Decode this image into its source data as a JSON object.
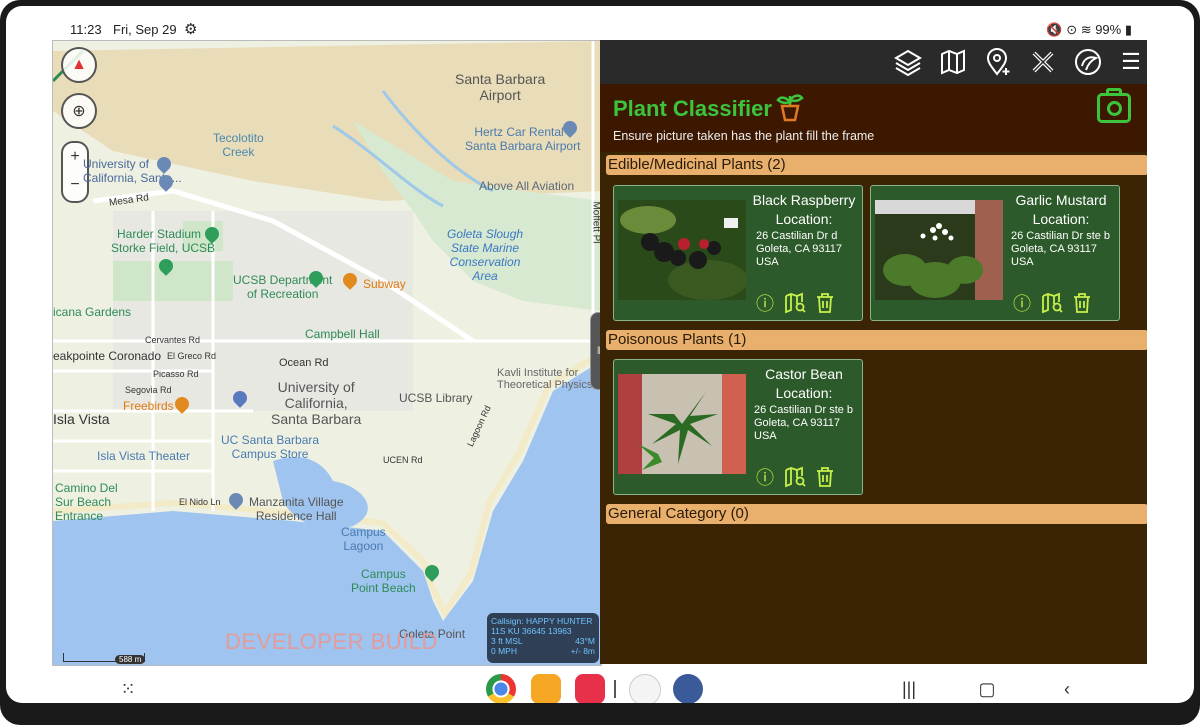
{
  "status": {
    "time": "11:23",
    "date": "Fri, Sep 29",
    "right": "99%"
  },
  "map": {
    "labels": {
      "sb_airport": "Santa Barbara\nAirport",
      "tecolotito": "Tecolotito\nCreek",
      "hertz": "Hertz Car Rental -\nSanta Barbara Airport",
      "above_all": "Above All Aviation",
      "univ_of": "University of\nCalifornia, Santa...",
      "mesa_rd": "Mesa Rd",
      "harder": "Harder Stadium",
      "storke": "Storke Field, UCSB",
      "goleta_slough": "Goleta Slough\nState Marine\nConservation\nArea",
      "moffett": "Moffett Pl",
      "ucsb_dept": "UCSB Department\nof Recreation",
      "subway": "Subway",
      "ucana": "icana Gardens",
      "campbell": "Campbell Hall",
      "cervantes": "Cervantes Rd",
      "el_greco": "El Greco Rd",
      "picasso": "Picasso Rd",
      "segovia": "Segovia Rd",
      "pointe": "eakpointe Coronado",
      "ocean": "Ocean Rd",
      "univ_cal": "University of\nCalifornia,\nSanta Barbara",
      "kavli": "Kavli Institute for\nTheoretical Physics",
      "ucsb_library": "UCSB Library",
      "freebirds": "Freebirds",
      "isla_vista": "Isla Vista",
      "uc_store": "UC Santa Barbara\nCampus Store",
      "iv_theater": "Isla Vista Theater",
      "ucen": "UCEN Rd",
      "lagoon": "Lagoon Rd",
      "camino": "Camino Del\nSur Beach\nEntrance",
      "el_nido": "El Nido Ln",
      "manzanita": "Manzanita Village\nResidence Hall",
      "campus_lagoon": "Campus\nLagoon",
      "campus_point": "Campus\nPoint Beach",
      "goleta_point": "Goleta Point"
    },
    "dev_build": "DEVELOPER BUILD",
    "scale": "588 m",
    "hud": {
      "callsign": "Callsign: HAPPY HUNTER",
      "coords": "11S  KU  36645  13963",
      "msl": "3 ft MSL",
      "deg": "43°M",
      "speed": "0 MPH",
      "acc": "+/- 8m"
    }
  },
  "panel": {
    "title": "Plant Classifier",
    "subtitle": "Ensure picture taken has the plant fill the frame",
    "sections": [
      {
        "title": "Edible/Medicinal Plants (2)"
      },
      {
        "title": "Poisonous Plants (1)"
      },
      {
        "title": "General Category (0)"
      }
    ],
    "cards": [
      {
        "name": "Black Raspberry",
        "loc": "Location:",
        "addr1": "26 Castilian Dr d",
        "addr2": "Goleta, CA 93117",
        "addr3": "USA"
      },
      {
        "name": "Garlic Mustard",
        "loc": "Location:",
        "addr1": "26 Castilian Dr ste b",
        "addr2": "Goleta, CA 93117",
        "addr3": "USA"
      },
      {
        "name": "Castor Bean",
        "loc": "Location:",
        "addr1": "26 Castilian Dr ste b",
        "addr2": "Goleta, CA 93117",
        "addr3": "USA"
      }
    ]
  },
  "colors": {
    "accent_green": "#3cc43c",
    "section_bar": "#e8b06c",
    "card_bg": "#2c5a2a",
    "panel_bg": "#3a2404"
  }
}
